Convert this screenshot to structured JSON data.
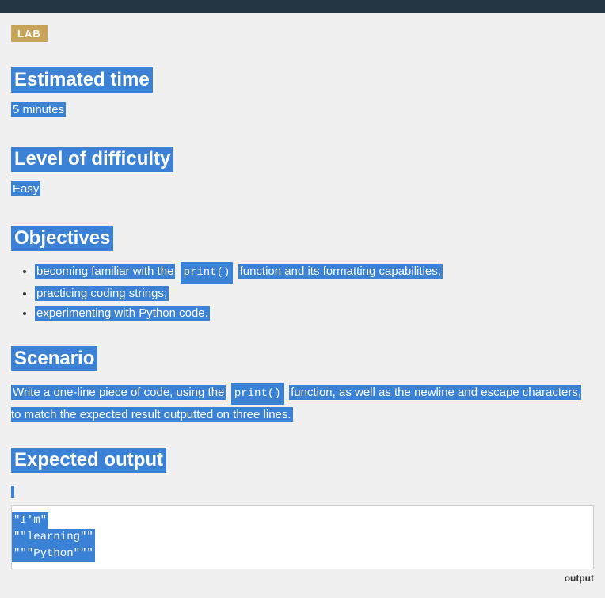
{
  "badge": "LAB",
  "headings": {
    "estimated_time": "Estimated time",
    "difficulty": "Level of difficulty",
    "objectives": "Objectives",
    "scenario": "Scenario",
    "expected_output": "Expected output"
  },
  "estimated_time_value": "5 minutes",
  "difficulty_value": "Easy",
  "objectives_items": {
    "0": {
      "pre": "becoming familiar with the",
      "code": "print()",
      "post": "function and its formatting capabilities;"
    },
    "1": "practicing coding strings;",
    "2": "experimenting with Python code."
  },
  "scenario_text": {
    "pre": "Write a one-line piece of code, using the",
    "code": "print()",
    "post": "function, as well as the newline and escape characters, to match the expected result outputted on three lines."
  },
  "expected_output_lines": {
    "0": "\"I'm\"",
    "1": "\"\"learning\"\"",
    "2": "\"\"\"Python\"\"\""
  },
  "output_label": "output"
}
